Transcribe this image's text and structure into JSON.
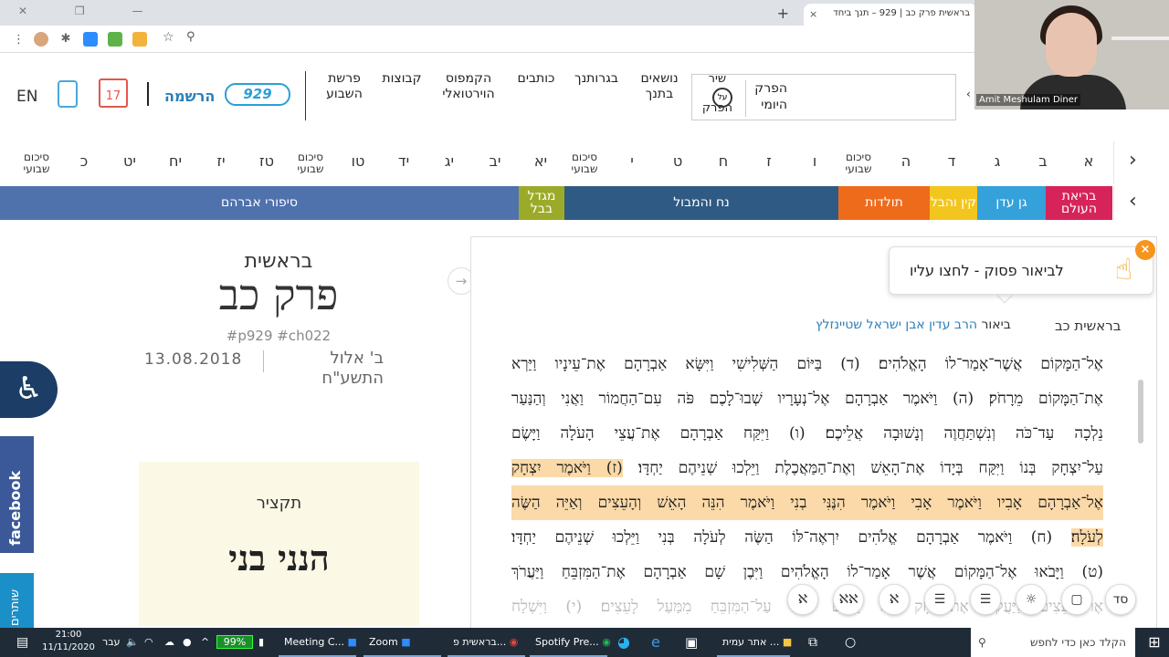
{
  "browser": {
    "tab_title": "בראשית פרק כב | 929 – תנך ביחד",
    "tab_close": "×",
    "new_tab": "+",
    "window_controls": "✕ ❐ —"
  },
  "header": {
    "language": "EN",
    "calendar_day": "17",
    "register": "הרשמה",
    "logo": "929",
    "nav": [
      {
        "l1": "פרשת",
        "l2": "השבוע"
      },
      {
        "l1": "קבוצות",
        "l2": ""
      },
      {
        "l1": "הקמפוס",
        "l2": "הוירטואלי"
      },
      {
        "l1": "כותבים",
        "l2": ""
      },
      {
        "l1": "בגרותנך",
        "l2": ""
      },
      {
        "l1": "נושאים",
        "l2": "בתנך"
      }
    ],
    "daily_chapter_l1": "הפרק",
    "daily_chapter_l2": "היומי",
    "song_l1": "שיר",
    "song_l2": "הפרק",
    "song_icon": "על"
  },
  "chapters": [
    "א",
    "ב",
    "ג",
    "ד",
    "ה",
    "סיכום שבועי",
    "ו",
    "ז",
    "ח",
    "ט",
    "י",
    "סיכום שבועי",
    "יא",
    "יב",
    "יג",
    "יד",
    "טו",
    "סיכום שבועי",
    "טז",
    "יז",
    "יח",
    "יט",
    "כ",
    "סיכום שבועי",
    "כ"
  ],
  "stories": [
    {
      "label": "בריאת העולם",
      "color": "#d6245a"
    },
    {
      "label": "גן עדן",
      "color": "#34a1da"
    },
    {
      "label": "קין והבל",
      "color": "#f2c61f"
    },
    {
      "label": "תולדות",
      "color": "#ef6b1c"
    },
    {
      "label": "נח והמבול",
      "color": "#2f5a83"
    },
    {
      "label": "מגדל בבל",
      "color": "#9bab29"
    },
    {
      "label": "סיפורי אברהם",
      "color": "#4f72ad"
    }
  ],
  "left": {
    "book": "בראשית",
    "chapter_title": "פרק כב",
    "tags": "#p929 #ch022",
    "gregorian_date": "13.08.2018",
    "hebrew_date_l1": "ב' אלול",
    "hebrew_date_l2": "התשע\"ח",
    "summary_label": "תקציר",
    "summary_title": "הנני בני"
  },
  "side": {
    "facebook": "facebook",
    "shut": "שותרים",
    "collapse_arrow": "→"
  },
  "panel": {
    "tooltip": "לביאור פסוק - לחצו עליו",
    "tooltip_close": "×",
    "reference": "בראשית כב",
    "commentary_prefix": "ביאור",
    "commentary_author": "הרב עדין אבן ישראל שטיינזלץ",
    "verses": [
      {
        "text": "אֶל־הַמָּקוֹם אֲשֶׁר־אָמַר־לוֹ הָאֱלֹהִים׃ (ד) בַּיּוֹם הַשְּׁלִישִׁי וַיִּשָּׂא אַבְרָהָם אֶת־עֵינָיו וַיַּרְא",
        "hl": false
      },
      {
        "text": "אֶת־הַמָּקוֹם מֵרָחֹק׃ (ה) וַיֹּאמֶר אַבְרָהָם אֶל־נְעָרָיו שְׁבוּ־לָכֶם פֹּה עִם־הַחֲמוֹר וַאֲנִי וְהַנַּעַר",
        "hl": false
      },
      {
        "text": "נֵלְכָה עַד־כֹּה וְנִשְׁתַּחֲוֶה וְנָשׁוּבָה אֲלֵיכֶם׃ (ו) וַיִּקַּח אַבְרָהָם אֶת־עֲצֵי הָעֹלָה וַיָּשֶׂם",
        "hl": false
      },
      {
        "text": "עַל־יִצְחָק בְּנוֹ וַיִּקַּח בְּיָדוֹ אֶת־הָאֵשׁ וְאֶת־הַמַּאֲכֶלֶת וַיֵּלְכוּ שְׁנֵיהֶם יַחְדָּו׃",
        "hl": false,
        "tail": "(ז) וַיֹּאמֶר יִצְחָק"
      },
      {
        "text": "אֶל־אַבְרָהָם אָבִיו וַיֹּאמֶר אָבִי וַיֹּאמֶר הִנֶּנִּי בְנִי וַיֹּאמֶר הִנֵּה הָאֵשׁ וְהָעֵצִים וְאַיֵּה הַשֶּׂה",
        "hl": true
      },
      {
        "text": "וַיֹּאמֶר אַבְרָהָם אֱלֹהִים יִרְאֶה־לּוֹ הַשֶּׂה לְעֹלָה בְּנִי וַיֵּלְכוּ שְׁנֵיהֶם יַחְדָּו׃",
        "hl": false,
        "head": "לְעֹלָה׃",
        "mid": "(ח)"
      },
      {
        "text": "(ט) וַיָּבֹאוּ אֶל־הַמָּקוֹם אֲשֶׁר אָמַר־לוֹ הָאֱלֹהִים וַיִּבֶן שָׁם אַבְרָהָם אֶת־הַמִּזְבֵּחַ וַיַּעֲרֹךְ",
        "hl": false
      },
      {
        "text": "אֶת־הָעֵצִים וַיַּעֲקֹד אֶת־יִצְחָק בְּנוֹ וַיָּשֶׂם אֹתוֹ עַל־הַמִּזְבֵּחַ מִמַּעַל לָעֵצִים׃ (י) וַיִּשְׁלַח",
        "hl": false
      }
    ],
    "tools": [
      "סד",
      "▢",
      "☼",
      "☰",
      "☰",
      "ℵ",
      "ℵℵ",
      "ℵ"
    ]
  },
  "webcam": {
    "name": "Amit Meshulam Diner"
  },
  "taskbar": {
    "time": "21:00",
    "date": "11/11/2020",
    "lang": "עבר",
    "battery": "99%",
    "apps": [
      "Meeting C...",
      "Zoom",
      "בראשית פ...",
      "Spotify Pre...",
      "אתר עמית ..."
    ],
    "search": "הקלד כאן כדי לחפש"
  }
}
